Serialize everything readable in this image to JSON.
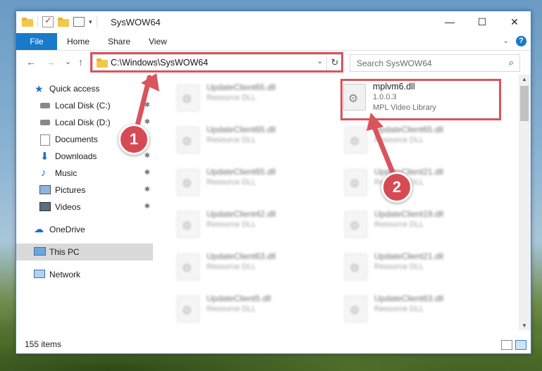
{
  "window": {
    "title": "SysWOW64",
    "controls": {
      "minimize": "—",
      "maximize": "☐",
      "close": "✕"
    }
  },
  "ribbon": {
    "tabs": [
      "File",
      "Home",
      "Share",
      "View"
    ],
    "help": "?"
  },
  "address_bar": {
    "path": "C:\\Windows\\SysWOW64",
    "refresh": "↻"
  },
  "search": {
    "placeholder": "Search SysWOW64"
  },
  "navigation": {
    "back": "←",
    "forward": "→",
    "recent": "⌄",
    "up": "↑"
  },
  "sidebar": {
    "items": [
      {
        "label": "Quick access",
        "icon": "star-icon",
        "pinned": false
      },
      {
        "label": "Local Disk (C:)",
        "icon": "drive-icon",
        "pinned": true
      },
      {
        "label": "Local Disk (D:)",
        "icon": "drive-icon",
        "pinned": true
      },
      {
        "label": "Documents",
        "icon": "documents-icon",
        "pinned": true
      },
      {
        "label": "Downloads",
        "icon": "downloads-icon",
        "pinned": true
      },
      {
        "label": "Music",
        "icon": "music-icon",
        "pinned": true
      },
      {
        "label": "Pictures",
        "icon": "pictures-icon",
        "pinned": true
      },
      {
        "label": "Videos",
        "icon": "videos-icon",
        "pinned": true
      },
      {
        "label": "OneDrive",
        "icon": "cloud-icon",
        "pinned": false
      },
      {
        "label": "This PC",
        "icon": "computer-icon",
        "pinned": false,
        "selected": true
      },
      {
        "label": "Network",
        "icon": "network-icon",
        "pinned": false
      }
    ]
  },
  "files": {
    "highlighted": {
      "name": "mplvm6.dll",
      "version": "1.0.0.3",
      "description": "MPL Video Library"
    },
    "left_column": [
      {
        "name": "UpdateClient65.dll",
        "type": "Resource DLL"
      },
      {
        "name": "UpdateClient65.dll",
        "type": "Resource DLL"
      },
      {
        "name": "UpdateClient65.dll",
        "type": "Resource DLL"
      },
      {
        "name": "UpdateClient42.dll",
        "type": "Resource DLL"
      },
      {
        "name": "UpdateClient63.dll",
        "type": "Resource DLL"
      },
      {
        "name": "UpdateClient5.dll",
        "type": "Resource DLL"
      }
    ],
    "right_column": [
      {
        "name": "UpdateClient65.dll",
        "type": "Resource DLL"
      },
      {
        "name": "UpdateClient21.dll",
        "type": "Resource DLL"
      },
      {
        "name": "UpdateClient19.dll",
        "type": "Resource DLL"
      },
      {
        "name": "UpdateClient21.dll",
        "type": "Resource DLL"
      },
      {
        "name": "UpdateClient63.dll",
        "type": "Resource DLL"
      }
    ]
  },
  "status_bar": {
    "item_count": "155 items"
  },
  "annotations": {
    "step1": "1",
    "step2": "2"
  },
  "colors": {
    "accent": "#1979ca",
    "highlight": "#d9545c"
  }
}
